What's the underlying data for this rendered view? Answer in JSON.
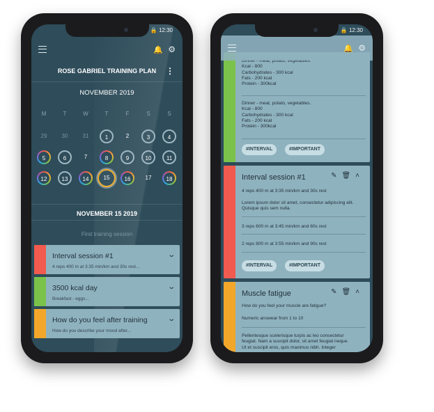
{
  "status": {
    "time": "12:30"
  },
  "left": {
    "plan_title": "ROSE GABRIEL TRAINING PLAN",
    "month": "NOVEMBER 2019",
    "weekdays": [
      "M",
      "T",
      "W",
      "T",
      "F",
      "S",
      "S"
    ],
    "rows": [
      [
        "29",
        "30",
        "31",
        "1",
        "2",
        "3",
        "4"
      ],
      [
        "5",
        "6",
        "7",
        "8",
        "9",
        "10",
        "11"
      ],
      [
        "12",
        "13",
        "14",
        "15",
        "16",
        "17",
        "18"
      ]
    ],
    "selected_date": "NOVEMBER 15 2019",
    "session_placeholder": "First training session",
    "cards": [
      {
        "title": "Interval session #1",
        "sub": "4 reps 400 m at 3:35 min/km and 30s rest...",
        "color": "#f05a4f"
      },
      {
        "title": "3500 kcal day",
        "sub": "Breakfast - eggs...",
        "color": "#7bc24b"
      },
      {
        "title": "How do you feel after training",
        "sub": "How do you describe your mood after...",
        "color": "#f2a72b"
      }
    ]
  },
  "right": {
    "nutrition": {
      "color": "#7bc24b",
      "blocks": [
        [
          "Dinner - meat, potato, vegetables.",
          "Kcal - 800",
          "Carbohydrates - 300 kcal",
          "Fats - 200 kcal",
          "Protein - 300kcal"
        ],
        [
          "Dinner - meat, potato, vegetables.",
          "Kcal - 800",
          "Carbohydrates - 300 kcal",
          "Fats - 200 kcal",
          "Protein - 300kcal"
        ]
      ],
      "tags": [
        "#INTERVAL",
        "#IMPORTANT"
      ]
    },
    "interval": {
      "color": "#f05a4f",
      "title": "Interval session #1",
      "line1": "4 reps 400 m at 3:35 min/km and 30s rest",
      "lorem": [
        "Lorem ipsum dolor sit amet, consectetur adipiscing elit.",
        "Quisque quis sem nulla."
      ],
      "line2": "3 reps 600 m at 3:45 min/km and 60s rest",
      "line3": "2 reps 800 m at 3:55 min/km and 90s rest",
      "tags": [
        "#INTERVAL",
        "#IMPORTANT"
      ]
    },
    "fatigue": {
      "color": "#f2a72b",
      "title": "Muscle fatigue",
      "q": "How do you feel your muscle are fatigue?",
      "hint": "Numeric answear from 1 to 10",
      "lorem": [
        "Pellentesque scelerisque turpis ac leo consectetur",
        "feugiat. Nam a suscipit dolor, sit amet feugiat neque.",
        "Ut et suscipit eros, quis maximus nibh. Integer"
      ]
    }
  },
  "icons": {
    "menu": "hamburger-icon",
    "bell": "bell-icon",
    "settings": "gear-icon",
    "edit": "pencil-icon",
    "delete": "trash-icon",
    "collapse": "chevron-up-icon",
    "expand": "chevron-down-icon"
  }
}
